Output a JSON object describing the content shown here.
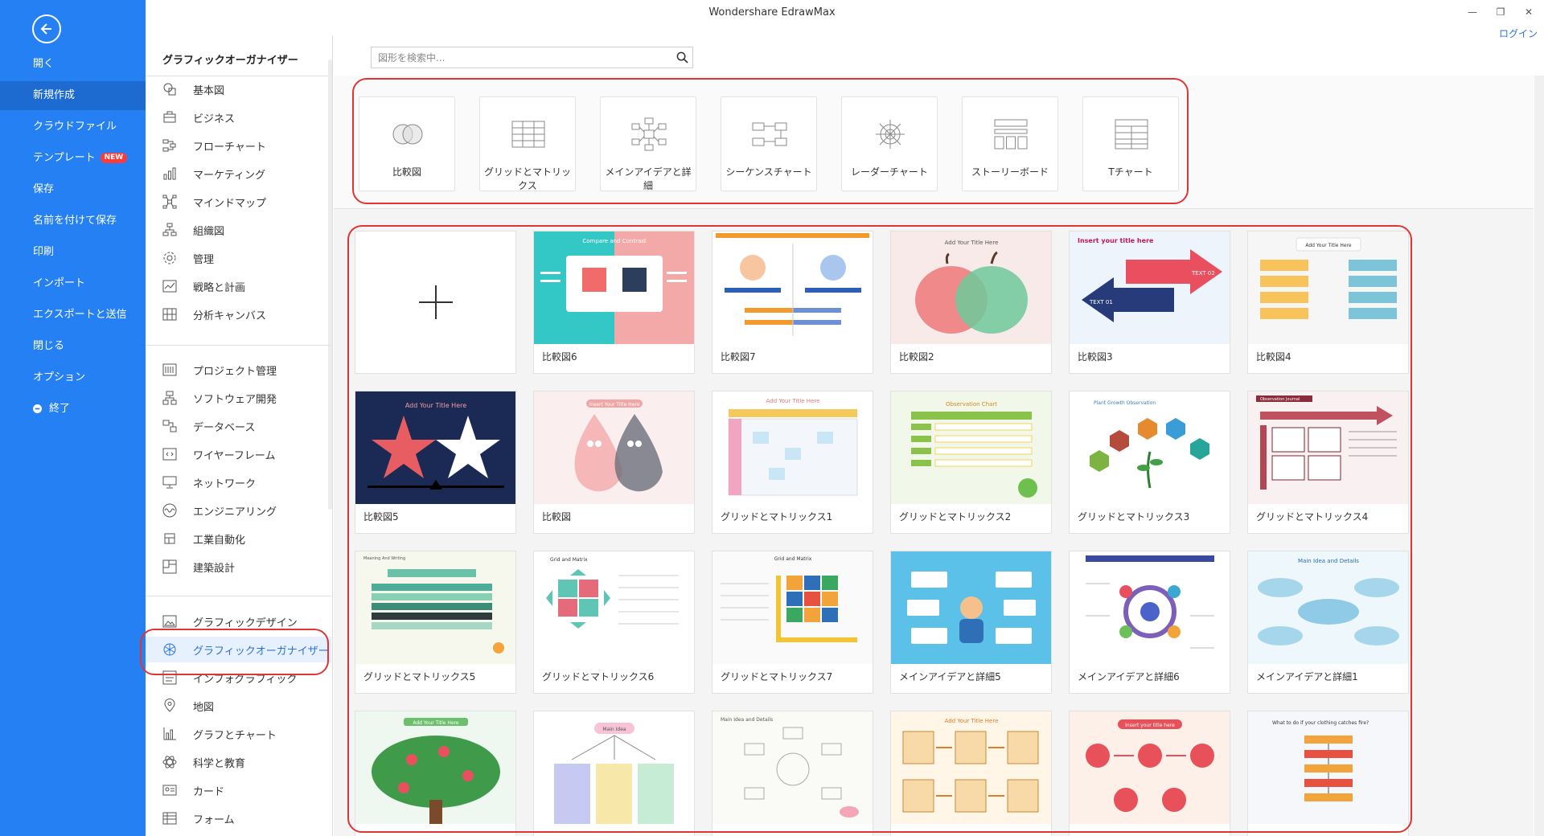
{
  "window": {
    "title": "Wondershare EdrawMax",
    "login": "ログイン"
  },
  "nav": {
    "back_icon": "arrow-left-icon",
    "items": [
      {
        "label": "開く"
      },
      {
        "label": "新規作成"
      },
      {
        "label": "クラウドファイル"
      },
      {
        "label": "テンプレート",
        "badge": "NEW"
      },
      {
        "label": "保存"
      },
      {
        "label": "名前を付けて保存"
      },
      {
        "label": "印刷"
      },
      {
        "label": "インポート"
      },
      {
        "label": "エクスポートと送信"
      },
      {
        "label": "閉じる"
      },
      {
        "label": "オプション"
      },
      {
        "label": "終了"
      }
    ]
  },
  "category_panel": {
    "title": "グラフィックオーガナイザー",
    "group1": [
      "基本図",
      "ビジネス",
      "フローチャート",
      "マーケティング",
      "マインドマップ",
      "組織図",
      "管理",
      "戦略と計画",
      "分析キャンバス"
    ],
    "group2": [
      "プロジェクト管理",
      "ソフトウェア開発",
      "データベース",
      "ワイヤーフレーム",
      "ネットワーク",
      "エンジニアリング",
      "工業自動化",
      "建築設計"
    ],
    "group3": [
      "グラフィックデザイン",
      "グラフィックオーガナイザー",
      "インフォグラフィック",
      "地図",
      "グラフとチャート",
      "科学と教育",
      "カード",
      "フォーム"
    ]
  },
  "search": {
    "placeholder": "図形を検索中..."
  },
  "diagram_types": [
    "比較図",
    "グリッドとマトリックス",
    "メインアイデアと詳細",
    "シーケンスチャート",
    "レーダーチャート",
    "ストーリーボード",
    "Tチャート"
  ],
  "templates": {
    "row1": [
      "比較図6",
      "比較図7",
      "比較図2",
      "比較図3",
      "比較図4"
    ],
    "row2": [
      "比較図5",
      "比較図",
      "グリッドとマトリックス1",
      "グリッドとマトリックス2",
      "グリッドとマトリックス3",
      "グリッドとマトリックス4"
    ],
    "row3": [
      "グリッドとマトリックス5",
      "グリッドとマトリックス6",
      "グリッドとマトリックス7",
      "メインアイデアと詳細5",
      "メインアイデアと詳細6",
      "メインアイデアと詳細1"
    ]
  },
  "thumbs": {
    "compare_contrast": "Compare and Contrast",
    "add_title": "Add Your Title Here",
    "insert_title": "Insert your title here",
    "text_01": "TEXT 01",
    "text_02": "TEXT 02",
    "insert_title_here": "Insert Your Title Here",
    "observation_chart": "Observation Chart",
    "plant_growth": "Plant Growth Observation",
    "observation_journal": "Observation Journal",
    "meaning_writing": "Meaning And Writing",
    "grid_matrix": "Grid and Matrix",
    "main_idea_details": "Main Idea and Details",
    "main_idea": "Main Idea",
    "what_to_do": "What to do if your clothing catches fire?"
  },
  "colors": {
    "nav_blue": "#2580f3",
    "highlight_red": "#e03535",
    "active_blue": "#2b73d9"
  }
}
